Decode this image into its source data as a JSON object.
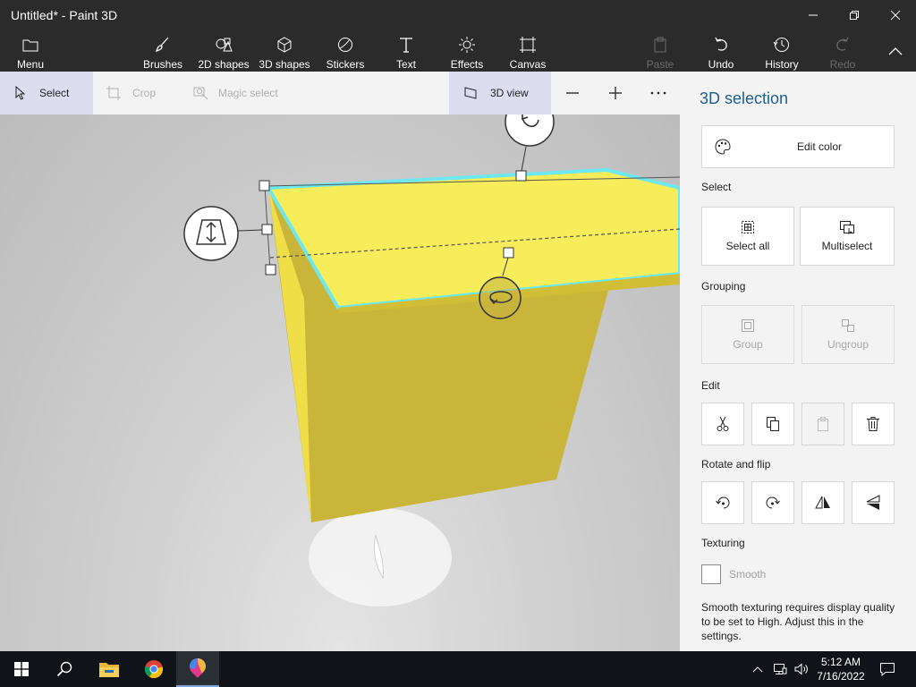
{
  "window": {
    "title": "Untitled* - Paint 3D"
  },
  "ribbon": {
    "menu": "Menu",
    "brushes": "Brushes",
    "shapes2d": "2D shapes",
    "shapes3d": "3D shapes",
    "stickers": "Stickers",
    "text": "Text",
    "effects": "Effects",
    "canvas": "Canvas",
    "paste": "Paste",
    "undo": "Undo",
    "history": "History",
    "redo": "Redo"
  },
  "toolbar": {
    "select": "Select",
    "crop": "Crop",
    "magic_select": "Magic select",
    "view3d": "3D view"
  },
  "panel": {
    "title": "3D selection",
    "edit_color": "Edit color",
    "select_heading": "Select",
    "select_all": "Select all",
    "multiselect": "Multiselect",
    "grouping_heading": "Grouping",
    "group": "Group",
    "ungroup": "Ungroup",
    "edit_heading": "Edit",
    "rotate_heading": "Rotate and flip",
    "texturing_heading": "Texturing",
    "smooth": "Smooth",
    "note": "Smooth texturing requires display quality to be set to High. Adjust this in the settings."
  },
  "taskbar": {
    "time": "5:12 AM",
    "date": "7/16/2022"
  },
  "colors": {
    "accent": "#1f5f8c",
    "selection_outline": "#6ee8f0",
    "object_top": "#f7ec5a",
    "object_side": "#c9b53a"
  }
}
